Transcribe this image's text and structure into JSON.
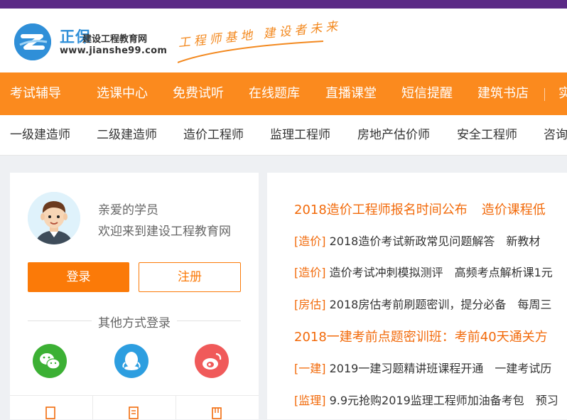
{
  "brand": {
    "name": "正保",
    "subtitle": "建设工程教育网",
    "url": "www.jianshe99.com",
    "slogan": "工程师基地 建设者未来"
  },
  "main_nav": [
    "考试辅导",
    "选课中心",
    "免费试听",
    "在线题库",
    "直播课堂",
    "短信提醒",
    "建筑书店",
    "实"
  ],
  "sub_nav": [
    "一级建造师",
    "二级建造师",
    "造价工程师",
    "监理工程师",
    "房地产估价师",
    "安全工程师",
    "咨询"
  ],
  "login_panel": {
    "greeting": "亲爱的学员",
    "welcome": "欢迎来到建设工程教育网",
    "login_label": "登录",
    "register_label": "注册",
    "other_login": "其他方式登录",
    "social_icons": [
      "wechat-icon",
      "qq-icon",
      "weibo-icon"
    ]
  },
  "news": {
    "headline1": {
      "a": "2018造价工程师报名时间公布",
      "b": "造价课程低"
    },
    "items1": [
      {
        "tag": "[造价]",
        "a": "2018造价考试新政常见问题解答",
        "b": "新教材"
      },
      {
        "tag": "[造价]",
        "a": "造价考试冲刺模拟测评",
        "b": "高频考点解析课1元"
      },
      {
        "tag": "[房估]",
        "a": "2018房估考前刷题密训，提分必备",
        "b": "每周三"
      }
    ],
    "headline2": {
      "a": "2018一建考前点题密训班：考前40天通关方"
    },
    "items2": [
      {
        "tag": "[一建]",
        "a": "2019一建习题精讲班课程开通",
        "b": "一建考试历"
      },
      {
        "tag": "[监理]",
        "a": "9.9元抢购2019监理工程师加油备考包",
        "b": "预习"
      }
    ]
  },
  "colors": {
    "top_bar": "#5b2a86",
    "nav_orange": "#fb8a1e",
    "accent_orange": "#f26a0a",
    "brand_blue": "#2f8fd8",
    "wechat": "#3cb034",
    "qq": "#2d9ee0",
    "weibo": "#f05a5a"
  }
}
